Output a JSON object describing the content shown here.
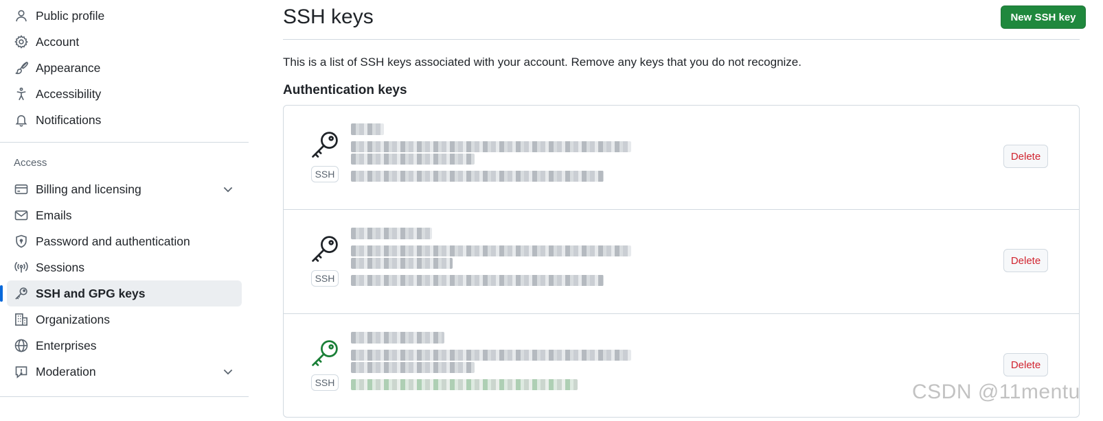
{
  "sidebar": {
    "top_items": [
      {
        "label": "Public profile",
        "icon": "person-icon"
      },
      {
        "label": "Account",
        "icon": "gear-icon"
      },
      {
        "label": "Appearance",
        "icon": "paintbrush-icon"
      },
      {
        "label": "Accessibility",
        "icon": "accessibility-icon"
      },
      {
        "label": "Notifications",
        "icon": "bell-icon"
      }
    ],
    "access_label": "Access",
    "access_items": [
      {
        "label": "Billing and licensing",
        "icon": "credit-card-icon",
        "expandable": true
      },
      {
        "label": "Emails",
        "icon": "mail-icon"
      },
      {
        "label": "Password and authentication",
        "icon": "shield-lock-icon"
      },
      {
        "label": "Sessions",
        "icon": "broadcast-icon"
      },
      {
        "label": "SSH and GPG keys",
        "icon": "key-icon",
        "active": true
      },
      {
        "label": "Organizations",
        "icon": "organization-icon"
      },
      {
        "label": "Enterprises",
        "icon": "globe-icon"
      },
      {
        "label": "Moderation",
        "icon": "report-icon",
        "expandable": true
      }
    ]
  },
  "main": {
    "title": "SSH keys",
    "new_key_label": "New SSH key",
    "intro": "This is a list of SSH keys associated with your account. Remove any keys that you do not recognize.",
    "section_heading": "Authentication keys",
    "keys": [
      {
        "badge": "SSH",
        "delete_label": "Delete",
        "recently_used": false
      },
      {
        "badge": "SSH",
        "delete_label": "Delete",
        "recently_used": false
      },
      {
        "badge": "SSH",
        "delete_label": "Delete",
        "recently_used": true
      }
    ]
  },
  "watermark": "CSDN @11mentu",
  "colors": {
    "primary_button": "#1f883d",
    "danger_text": "#d1242f",
    "active_indicator": "#0969da",
    "recent_key": "#1a7f37"
  }
}
